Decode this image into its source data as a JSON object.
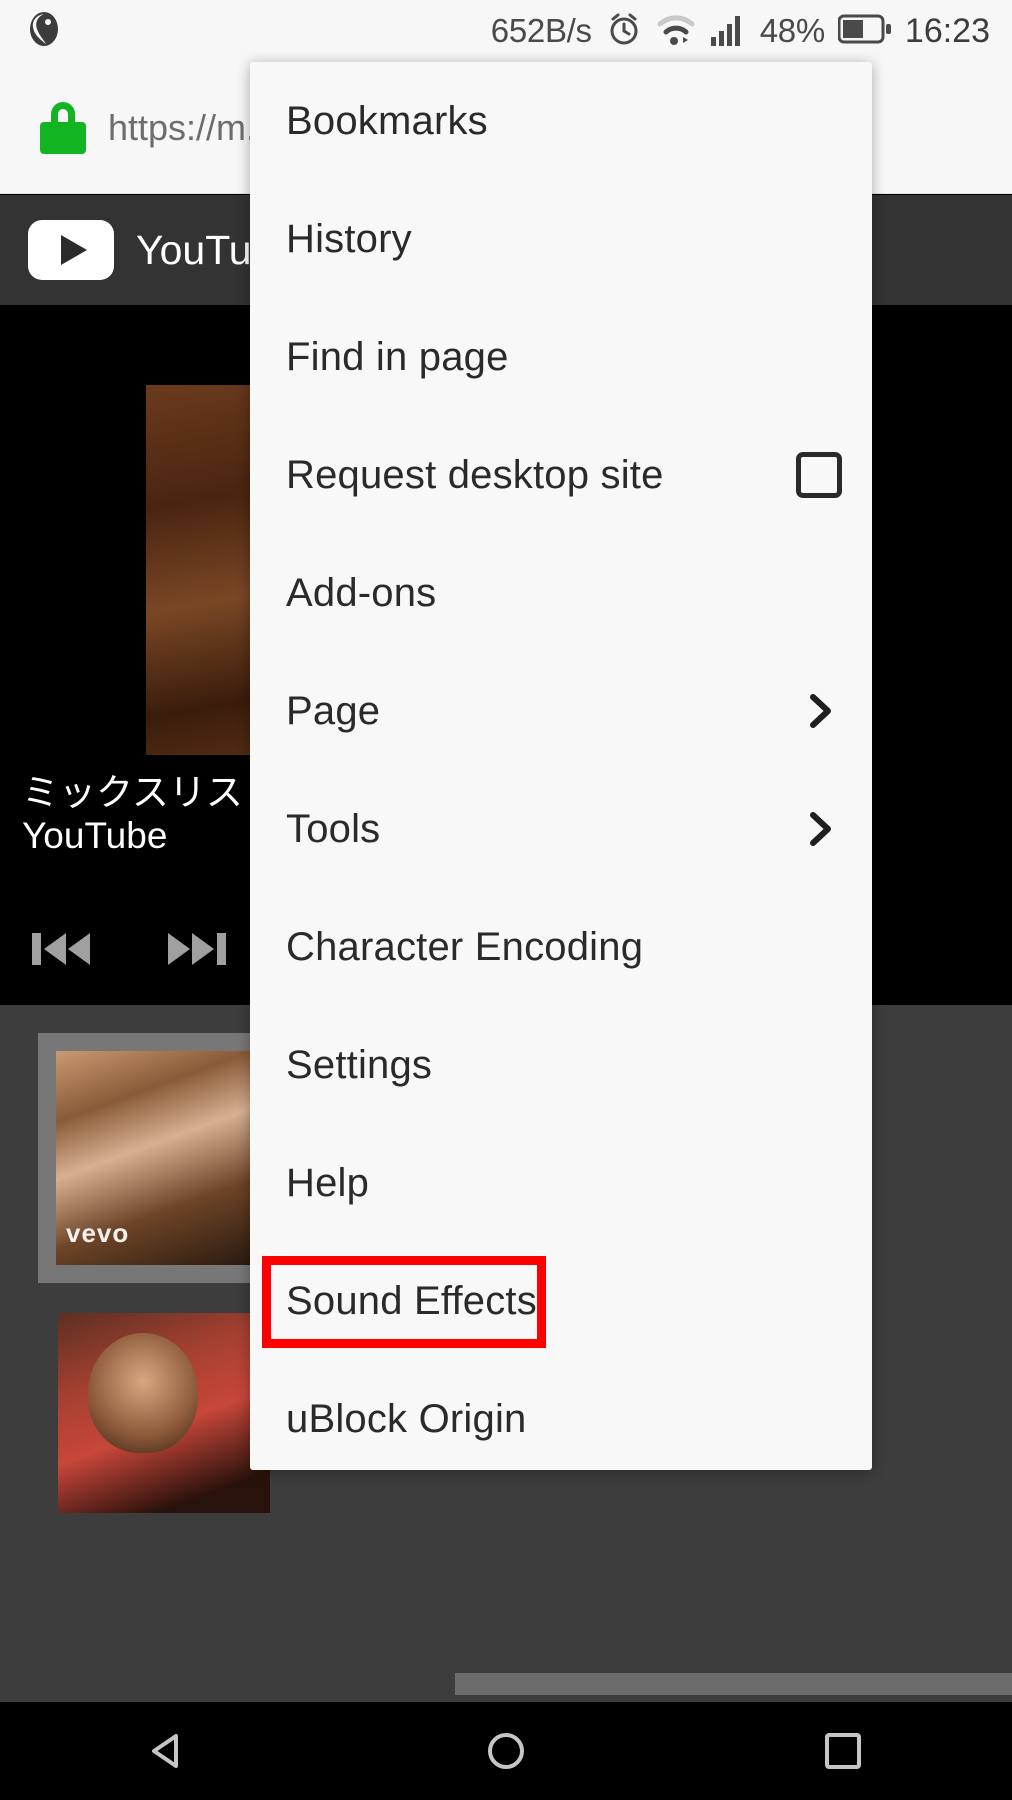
{
  "statusbar": {
    "browser_icon": "firefox-icon",
    "network_speed": "652B/s",
    "alarm_icon": "alarm-clock-icon",
    "wifi_icon": "wifi-icon",
    "signal_icon": "cellular-signal-icon",
    "battery_percent": "48%",
    "battery_icon": "battery-icon",
    "time": "16:23"
  },
  "urlbar": {
    "lock_icon": "lock-icon",
    "lock_color": "#12b521",
    "url": "https://m."
  },
  "page": {
    "site_header": {
      "logo_icon": "youtube-logo-icon",
      "site_name": "YouTub"
    },
    "video": {
      "title": "ミックスリスト",
      "channel": "YouTube",
      "prev_icon": "skip-previous-icon",
      "next_icon": "skip-next-icon"
    },
    "cards": {
      "card1_badge": "vevo"
    }
  },
  "menu": {
    "items": [
      {
        "label": "Bookmarks",
        "type": "plain"
      },
      {
        "label": "History",
        "type": "plain"
      },
      {
        "label": "Find in page",
        "type": "plain"
      },
      {
        "label": "Request desktop site",
        "type": "checkbox",
        "checked": false
      },
      {
        "label": "Add-ons",
        "type": "plain"
      },
      {
        "label": "Page",
        "type": "submenu"
      },
      {
        "label": "Tools",
        "type": "submenu"
      },
      {
        "label": "Character Encoding",
        "type": "plain"
      },
      {
        "label": "Settings",
        "type": "plain"
      },
      {
        "label": "Help",
        "type": "plain"
      },
      {
        "label": "Sound Effects",
        "type": "plain",
        "highlighted": true
      },
      {
        "label": "uBlock Origin",
        "type": "plain"
      }
    ],
    "highlight_color": "#ff0000",
    "chevron_icon": "chevron-right-icon",
    "checkbox_icon": "checkbox-unchecked-icon"
  },
  "navbar": {
    "back_icon": "back-triangle-icon",
    "home_icon": "home-circle-icon",
    "recents_icon": "recents-square-icon"
  }
}
